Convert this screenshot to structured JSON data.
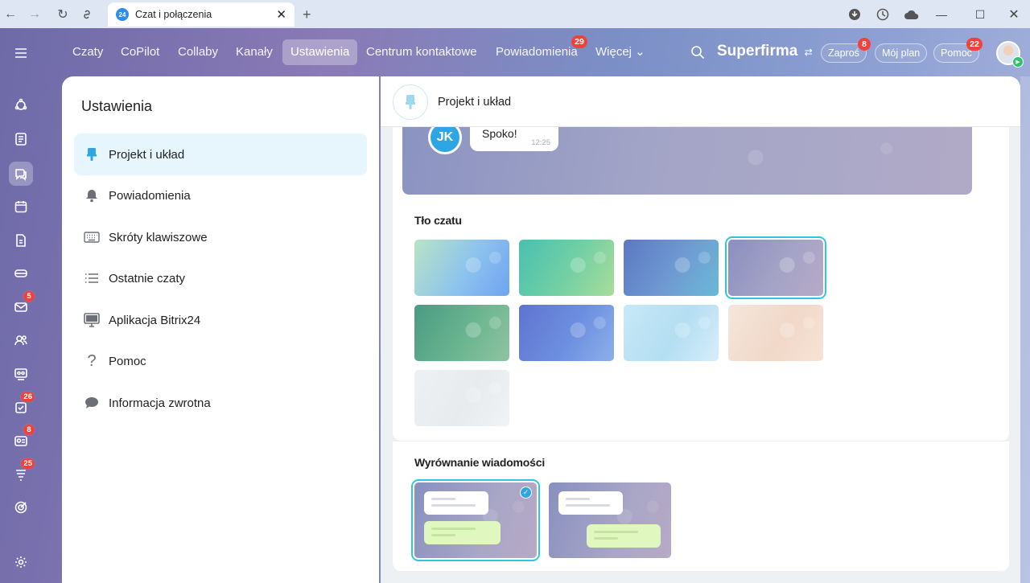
{
  "browser": {
    "tab_title": "Czat i połączenia",
    "tab_favicon": "24"
  },
  "topnav": {
    "items": [
      {
        "label": "Czaty"
      },
      {
        "label": "CoPilot"
      },
      {
        "label": "Collaby"
      },
      {
        "label": "Kanały"
      },
      {
        "label": "Ustawienia",
        "active": true
      },
      {
        "label": "Centrum kontaktowe"
      },
      {
        "label": "Powiadomienia",
        "badge": "29"
      },
      {
        "label": "Więcej ⌄"
      }
    ],
    "brand": "Superfirma",
    "invite": {
      "label": "Zaproś",
      "badge": "8"
    },
    "plan": {
      "label": "Mój plan"
    },
    "help": {
      "label": "Pomoc",
      "badge": "22"
    }
  },
  "rail": {
    "badges": {
      "mail": "5",
      "tasks": "26",
      "crm": "8",
      "feed": "25"
    }
  },
  "settings": {
    "title": "Ustawienia",
    "menu": [
      {
        "label": "Projekt i układ",
        "icon": "brush-icon",
        "active": true
      },
      {
        "label": "Powiadomienia",
        "icon": "bell-icon"
      },
      {
        "label": "Skróty klawiszowe",
        "icon": "keyboard-icon"
      },
      {
        "label": "Ostatnie czaty",
        "icon": "list-icon"
      },
      {
        "label": "Aplikacja Bitrix24",
        "icon": "monitor-icon"
      },
      {
        "label": "Pomoc",
        "icon": "question-icon"
      },
      {
        "label": "Informacja zwrotna",
        "icon": "chat-bubble-icon"
      }
    ]
  },
  "panel": {
    "title": "Projekt i układ",
    "preview": {
      "avatar": "JK",
      "message": "Spoko!",
      "time": "12:25"
    },
    "background_title": "Tło czatu",
    "backgrounds": [
      {
        "gradient": "linear-gradient(120deg,#b9e3c6,#8cc3ee 55%,#6fa3f1)"
      },
      {
        "gradient": "linear-gradient(120deg,#49c0b0,#74d0a4 55%,#a9dd9a)"
      },
      {
        "gradient": "linear-gradient(120deg,#5c78c2,#6f9bd2 55%,#6bb9d8)"
      },
      {
        "gradient": "linear-gradient(120deg,#8b8fc0,#a4a3c6 55%,#b7aac6)",
        "selected": true
      },
      {
        "gradient": "linear-gradient(120deg,#4a9b84,#6bb58f 55%,#8fc4a2)"
      },
      {
        "gradient": "linear-gradient(120deg,#5f74d0,#6d8fe0 55%,#8cb0ea)"
      },
      {
        "gradient": "linear-gradient(120deg,#c6e9f6,#b4def2 55%,#d6eefa)"
      },
      {
        "gradient": "linear-gradient(120deg,#f4e6dc,#f1d8c8 55%,#f6e3d6)"
      },
      {
        "gradient": "linear-gradient(120deg,#eef1f3,#e7ebee 55%,#f1f3f5)"
      }
    ],
    "alignment_title": "Wyrównanie wiadomości",
    "alignments": [
      {
        "mode": "left",
        "selected": true
      },
      {
        "mode": "right"
      }
    ]
  }
}
